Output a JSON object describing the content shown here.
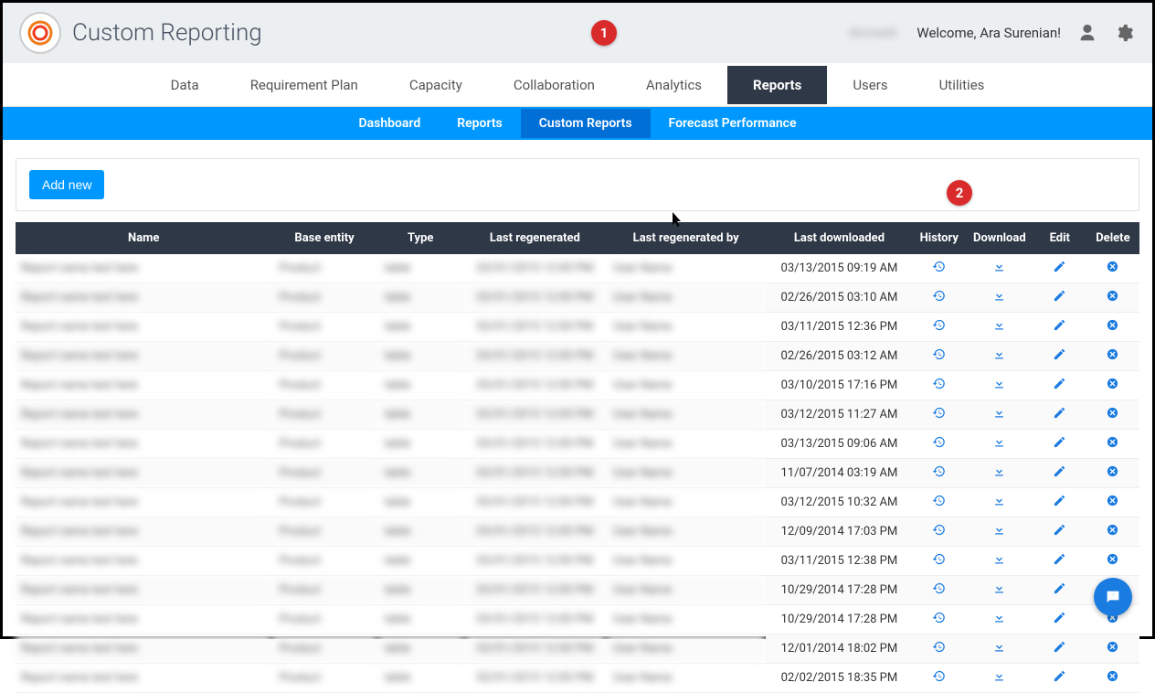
{
  "header": {
    "app_title": "Custom Reporting",
    "welcome": "Welcome, Ara Surenian!"
  },
  "main_nav": {
    "items": [
      "Data",
      "Requirement Plan",
      "Capacity",
      "Collaboration",
      "Analytics",
      "Reports",
      "Users",
      "Utilities"
    ],
    "active": "Reports"
  },
  "sub_nav": {
    "items": [
      "Dashboard",
      "Reports",
      "Custom Reports",
      "Forecast Performance"
    ],
    "active": "Custom Reports"
  },
  "toolbar": {
    "add_new": "Add new"
  },
  "table": {
    "headers": {
      "name": "Name",
      "base_entity": "Base entity",
      "type": "Type",
      "last_regenerated": "Last regenerated",
      "last_regenerated_by": "Last regenerated by",
      "last_downloaded": "Last downloaded",
      "history": "History",
      "download": "Download",
      "edit": "Edit",
      "delete": "Delete"
    },
    "rows": [
      {
        "last_downloaded": "03/13/2015 09:19 AM"
      },
      {
        "last_downloaded": "02/26/2015 03:10 AM"
      },
      {
        "last_downloaded": "03/11/2015 12:36 PM"
      },
      {
        "last_downloaded": "02/26/2015 03:12 AM"
      },
      {
        "last_downloaded": "03/10/2015 17:16 PM"
      },
      {
        "last_downloaded": "03/12/2015 11:27 AM"
      },
      {
        "last_downloaded": "03/13/2015 09:06 AM"
      },
      {
        "last_downloaded": "11/07/2014 03:19 AM"
      },
      {
        "last_downloaded": "03/12/2015 10:32 AM"
      },
      {
        "last_downloaded": "12/09/2014 17:03 PM"
      },
      {
        "last_downloaded": "03/11/2015 12:38 PM"
      },
      {
        "last_downloaded": "10/29/2014 17:28 PM"
      },
      {
        "last_downloaded": "10/29/2014 17:28 PM"
      },
      {
        "last_downloaded": "12/01/2014 18:02 PM"
      },
      {
        "last_downloaded": "02/02/2015 18:35 PM"
      }
    ]
  },
  "callouts": {
    "c1": "1",
    "c2": "2"
  }
}
